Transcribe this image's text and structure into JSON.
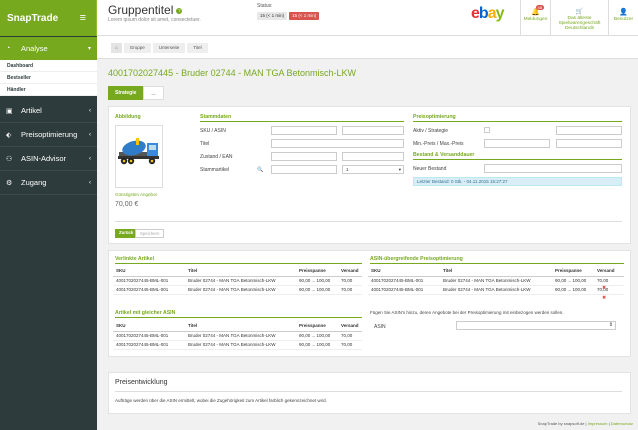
{
  "brand": {
    "name": "SnapTrade",
    "menu_glyph": "≡"
  },
  "nav": {
    "analyse": "Analyse",
    "sub": [
      "Dashboard",
      "Bestseller",
      "Händler"
    ],
    "artikel": "Artikel",
    "preis": "Preisoptimierung",
    "asin": "ASIN-Advisor",
    "zugang": "Zugang"
  },
  "header": {
    "title": "Gruppentitel",
    "subtitle": "Lorem ipsum dolor sit amet, consectetuer.",
    "status_label": "Status:",
    "badge1": "15 (< 1 min)",
    "badge2": "15 (< 1 min)",
    "ebay": {
      "e": "e",
      "b": "b",
      "a": "a",
      "y": "y"
    },
    "btn_meldungen": "Meldungen",
    "meldungen_count": "48",
    "btn_shop_line1": "Das älteste",
    "btn_shop_line2": "Spielwarengeschäft",
    "btn_shop_line3": "Deutschlands",
    "btn_benutzer": "Benutzer"
  },
  "breadcrumb": {
    "home": "⌂",
    "items": [
      "Gruppe",
      "Unterseite",
      "Titel"
    ]
  },
  "product": {
    "title": "4001702027445 - Bruder 02744 - MAN TGA Betonmisch-LKW"
  },
  "tabs": {
    "strategie": "Strategie",
    "other": "..."
  },
  "abbildung": {
    "heading": "Abbildung",
    "price_label": "Günstigsten Angebot",
    "price": "70,00 €"
  },
  "stammdaten": {
    "heading": "Stammdaten",
    "sku": "SKU / ASIN",
    "titel": "Titel",
    "zustand": "Zustand / EAN",
    "stammartikel": "Stammartikel",
    "select_value": "1"
  },
  "preisopt": {
    "heading": "Preisoptimierung",
    "aktiv": "Aktiv / Strategie",
    "minmax": "Min.-Preis / Max.-Preis",
    "bestand_heading": "Bestand & Versanddauer",
    "neuer_bestand": "Neuer Bestand",
    "letzter": "Letzter Bestand: 0 Stk. - 04.11.2015 15:27:27"
  },
  "buttons": {
    "zurueck": "Zurück",
    "speichern": "Speichern"
  },
  "verlinkt": {
    "heading": "Verlinkte Artikel",
    "cols": [
      "SKU",
      "Titel",
      "Preisspanne",
      "Versand"
    ],
    "rows": [
      [
        "4001702027445-BML-001",
        "Bruder 02744 - MAN TGA Betonmisch-LKW",
        "90,00 ... 100,00",
        "70,00"
      ],
      [
        "4001702027445-BML-001",
        "Bruder 02744 - MAN TGA Betonmisch-LKW",
        "90,00 ... 100,00",
        "70,00"
      ]
    ]
  },
  "gleiche": {
    "heading": "Artikel mit gleicher ASIN",
    "cols": [
      "SKU",
      "Titel",
      "Preisspanne",
      "Versand"
    ],
    "rows": [
      [
        "4001702027445-BML-001",
        "Bruder 02744 - MAN TGA Betonmisch-LKW",
        "90,00 ... 100,00",
        "70,00"
      ],
      [
        "4001702027445-BML-001",
        "Bruder 02744 - MAN TGA Betonmisch-LKW",
        "90,00 ... 100,00",
        "70,00"
      ]
    ]
  },
  "asinopt": {
    "heading": "ASIN-übergreifende Preisoptimierung",
    "cols": [
      "SKU",
      "Titel",
      "Preisspanne",
      "Versand"
    ],
    "rows": [
      [
        "4001702027445-BML-001",
        "Bruder 02744 - MAN TGA Betonmisch-LKW",
        "90,00 ... 100,00",
        "70,00"
      ],
      [
        "4001702027445-BML-001",
        "Bruder 02744 - MAN TGA Betonmisch-LKW",
        "90,00 ... 100,00",
        "70,00"
      ]
    ],
    "hint": "Fügen Sie ASIN's hinzu, deren Angebote bei der Preisoptimierung mit einbezogen werden sollen.",
    "asin_label": "ASIN"
  },
  "preisentwicklung": {
    "heading": "Preisentwicklung",
    "text": "Aufträge werden über die ASIN ermittelt, wobei die Zugehörigkeit zum Artikel farblich gekennzeichnet wird."
  },
  "footer": {
    "prefix": "SnapTrade by snapsoft.de |",
    "impressum": "Impressum",
    "sep": "|",
    "datenschutz": "Datenschutz"
  },
  "colors": {
    "accent": "#77a91f",
    "sidebar": "#2e3b3c",
    "danger": "#d9534f"
  }
}
